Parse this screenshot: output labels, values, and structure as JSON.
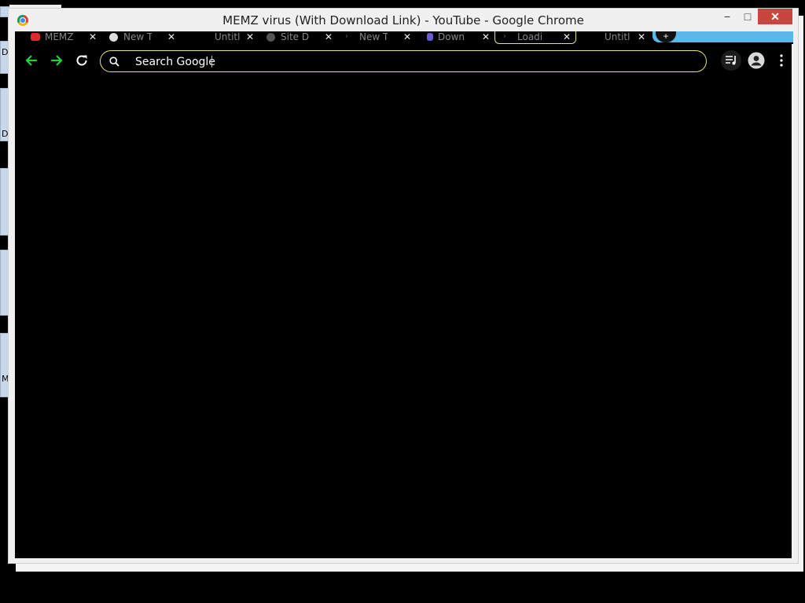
{
  "desktop": {
    "letters": [
      "D",
      "D",
      "M"
    ]
  },
  "window": {
    "title": "MEMZ virus (With Download Link) - YouTube - Google Chrome",
    "controls": {
      "minimize": "−",
      "maximize": "□",
      "close": "✕"
    }
  },
  "tabs": [
    {
      "label": "MEMZ",
      "close": "✕",
      "icon": "youtube-icon",
      "color": "#e02a2a"
    },
    {
      "label": "New T",
      "close": "✕",
      "icon": "github-icon",
      "color": "#dddddd"
    },
    {
      "label": "Untitl",
      "close": "✕",
      "icon": "blank-icon",
      "color": "#000000"
    },
    {
      "label": "Site D",
      "close": "✕",
      "icon": "globe-icon",
      "color": "#555555"
    },
    {
      "label": "New T",
      "close": "✕",
      "icon": "chevron-icon",
      "color": "#333333"
    },
    {
      "label": "Down",
      "close": "✕",
      "icon": "download-icon",
      "color": "#6a5ad8"
    },
    {
      "label": "Loadi",
      "close": "✕",
      "icon": "chevron-icon",
      "color": "#333333"
    },
    {
      "label": "Untitl",
      "close": "✕",
      "icon": "blank-icon",
      "color": "#000000"
    }
  ],
  "new_tab_label": "+",
  "toolbar": {
    "search_placeholder": "Search Google",
    "accent": "#21d23a",
    "omnibox_border": "#e9e56a"
  },
  "colors": {
    "close_button": "#c7463f",
    "new_tab_strip": "#5bb7e8"
  }
}
